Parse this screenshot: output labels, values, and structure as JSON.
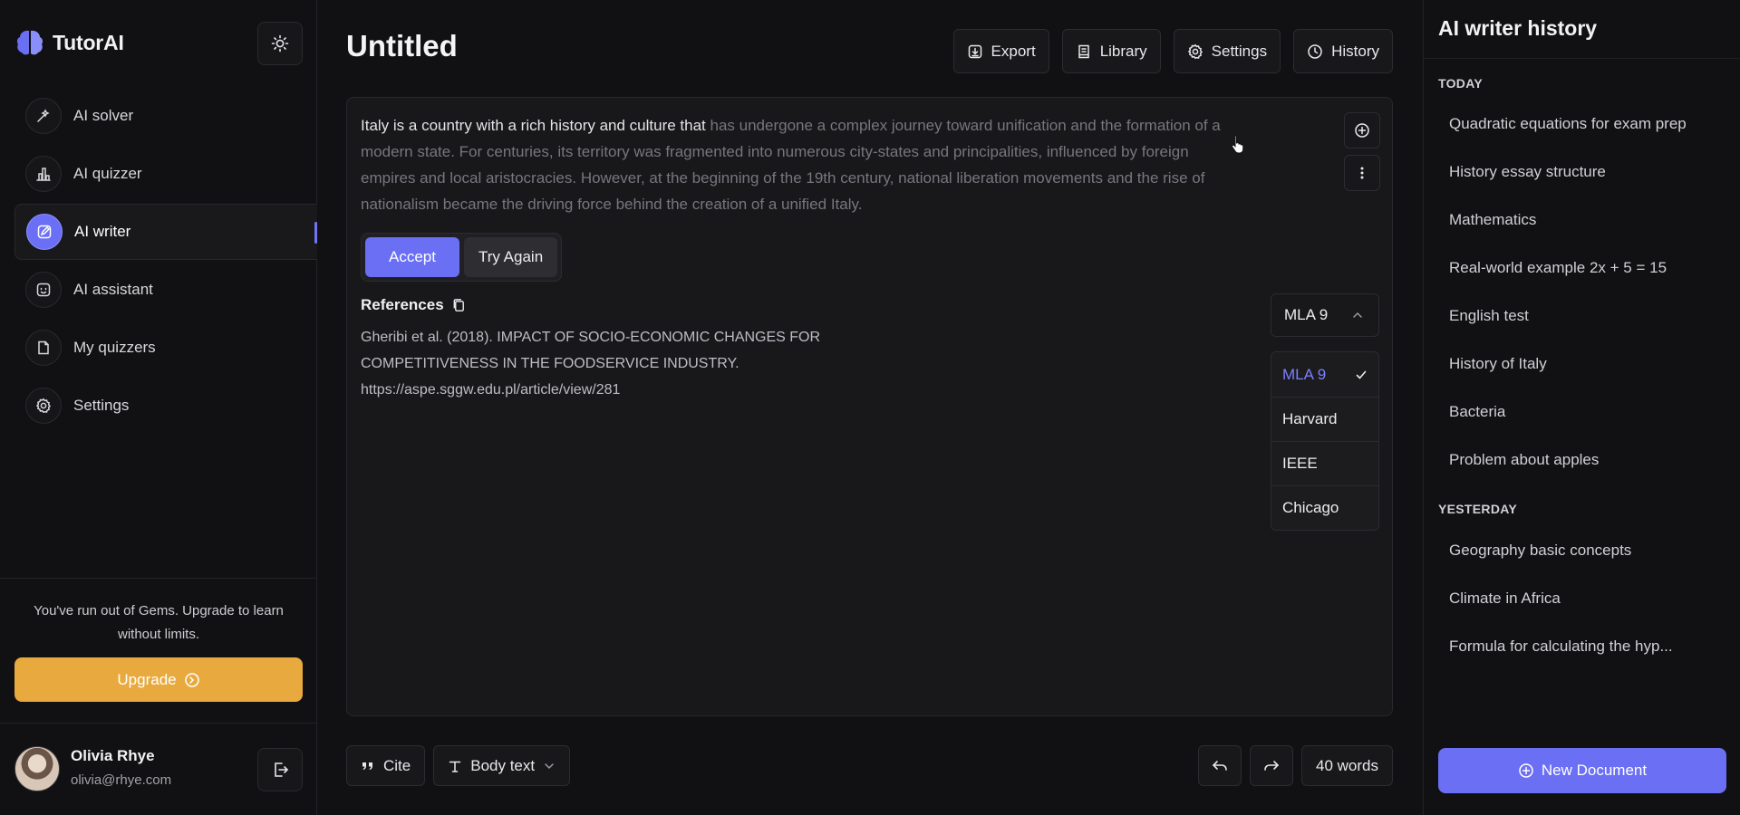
{
  "app": {
    "name": "TutorAI",
    "accent": "#6a6ff3",
    "upgrade_color": "#e8aa3e"
  },
  "sidebar": {
    "items": [
      {
        "label": "AI solver",
        "icon": "sparkle-wand-icon",
        "active": false
      },
      {
        "label": "AI quizzer",
        "icon": "bar-chart-icon",
        "active": false
      },
      {
        "label": "AI writer",
        "icon": "edit-note-icon",
        "active": true
      },
      {
        "label": "AI assistant",
        "icon": "bot-face-icon",
        "active": false
      },
      {
        "label": "My quizzers",
        "icon": "document-icon",
        "active": false
      },
      {
        "label": "Settings",
        "icon": "gear-icon",
        "active": false
      }
    ],
    "promo_text": "You've run out of Gems. Upgrade to learn without limits.",
    "upgrade_label": "Upgrade",
    "user": {
      "name": "Olivia Rhye",
      "email": "olivia@rhye.com"
    }
  },
  "header": {
    "title": "Untitled",
    "toolbar": {
      "export": "Export",
      "library": "Library",
      "settings": "Settings",
      "history": "History"
    }
  },
  "editor": {
    "accepted_text": "Italy is a country with a rich history and culture that ",
    "suggested_text": "has undergone a complex journey toward unification and the formation of a modern state. For centuries, its territory was fragmented into numerous city-states and principalities, influenced by foreign empires and local aristocracies. However, at the beginning of the 19th century, national liberation movements and the rise of nationalism became the driving force behind the creation of a unified Italy.",
    "accept_label": "Accept",
    "try_again_label": "Try Again",
    "references_title": "References",
    "reference_text": "Gheribi et al. (2018). IMPACT OF SOCIO-ECONOMIC CHANGES FOR COMPETITIVENESS IN THE FOODSERVICE INDUSTRY. https://aspe.sggw.edu.pl/article/view/281",
    "citation_style": {
      "selected": "MLA 9",
      "options": [
        "MLA 9",
        "Harvard",
        "IEEE",
        "Chicago"
      ]
    }
  },
  "bottom": {
    "cite_label": "Cite",
    "format_label": "Body text",
    "word_count": "40 words"
  },
  "history": {
    "title": "AI writer history",
    "today_label": "TODAY",
    "today": [
      "Quadratic equations for exam prep",
      "History essay structure",
      "Mathematics",
      "Real-world example 2x + 5 = 15",
      "English test",
      "History of Italy",
      "Bacteria",
      "Problem about apples"
    ],
    "yesterday_label": "YESTERDAY",
    "yesterday": [
      "Geography basic concepts",
      "Climate in Africa",
      "Formula for calculating the hyp..."
    ],
    "new_document_label": "New Document"
  }
}
